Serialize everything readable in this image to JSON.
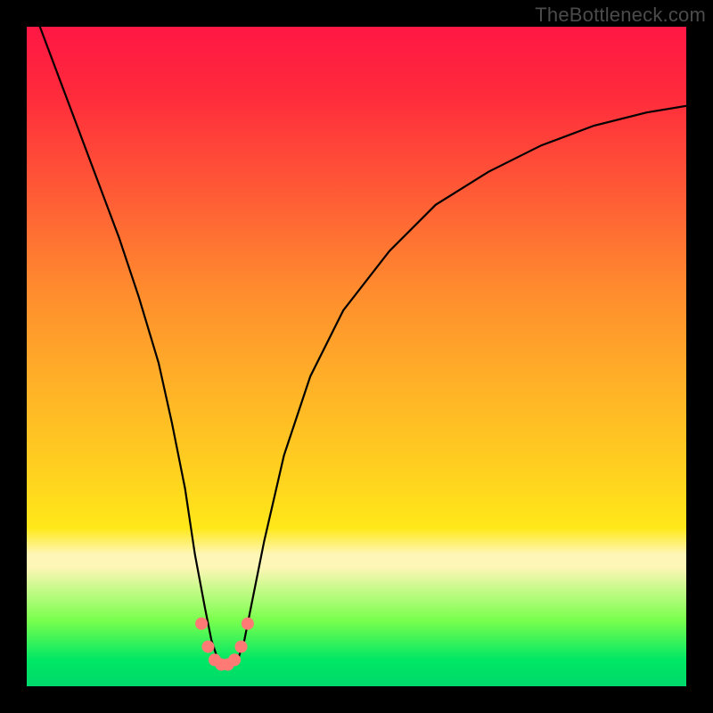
{
  "watermark": "TheBottleneck.com",
  "chart_data": {
    "type": "line",
    "title": "",
    "xlabel": "",
    "ylabel": "",
    "xlim": [
      0,
      100
    ],
    "ylim": [
      0,
      100
    ],
    "series": [
      {
        "name": "bottleneck-curve",
        "x": [
          2,
          5,
          8,
          11,
          14,
          17,
          20,
          22,
          24,
          25.5,
          27,
          28,
          29,
          30,
          31,
          32,
          33,
          34,
          36,
          39,
          43,
          48,
          55,
          62,
          70,
          78,
          86,
          94,
          100
        ],
        "values": [
          100,
          92,
          84,
          76,
          68,
          59,
          49,
          40,
          30,
          20,
          12,
          7,
          4,
          3,
          3,
          4,
          7,
          12,
          22,
          35,
          47,
          57,
          66,
          73,
          78,
          82,
          85,
          87,
          88
        ]
      },
      {
        "name": "marker-dots",
        "x": [
          26.5,
          27.5,
          28.5,
          29.5,
          30.5,
          31.5,
          32.5,
          33.5
        ],
        "values": [
          9.5,
          6.0,
          4.0,
          3.3,
          3.3,
          4.0,
          6.0,
          9.5
        ]
      }
    ],
    "colors": {
      "curve": "#000000",
      "dots": "#ff7a75"
    }
  }
}
